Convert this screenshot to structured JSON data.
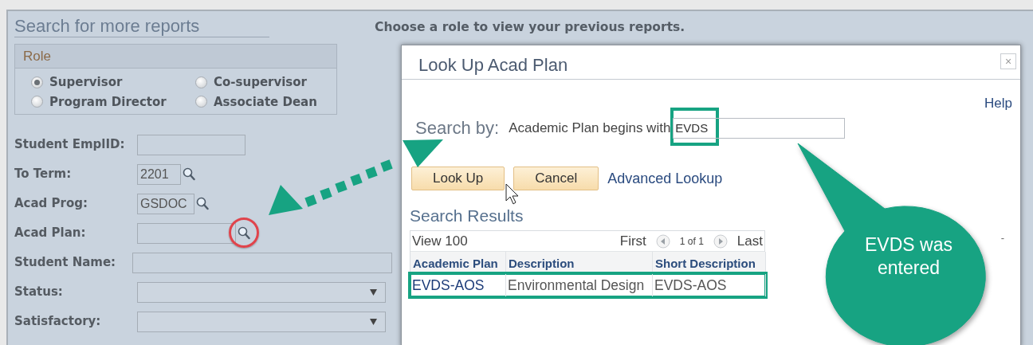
{
  "page": {
    "heading": "Search for more reports",
    "instruction": "Choose a role to view your previous reports."
  },
  "role": {
    "title": "Role",
    "options": [
      {
        "label": "Supervisor",
        "selected": true
      },
      {
        "label": "Co-supervisor",
        "selected": false
      },
      {
        "label": "Program Director",
        "selected": false
      },
      {
        "label": "Associate Dean",
        "selected": false
      }
    ]
  },
  "fields": [
    {
      "label": "Student EmplID:",
      "kind": "text"
    },
    {
      "label": "To Term:",
      "kind": "lookup",
      "value": "2201",
      "highlighted": false
    },
    {
      "label": "Acad Prog:",
      "kind": "lookup",
      "value": "GSDOC",
      "highlighted": false
    },
    {
      "label": "Acad Plan:",
      "kind": "lookup",
      "highlighted": true
    },
    {
      "label": "Student Name:",
      "kind": "text"
    },
    {
      "label": "Status:",
      "kind": "dropdown"
    },
    {
      "label": "Satisfactory:",
      "kind": "dropdown"
    }
  ],
  "dialog": {
    "title": "Look Up Acad Plan",
    "close": "×",
    "help": "Help",
    "search_by": "Search by:",
    "criterion": "Academic Plan begins with",
    "value": "EVDS",
    "buttons": [
      {
        "label": "Look Up"
      },
      {
        "label": "Cancel"
      }
    ],
    "link": "Advanced Lookup",
    "results": {
      "title": "Search Results",
      "view": "View 100",
      "first": "First",
      "page": "1 of 1",
      "last": "Last",
      "columns": [
        "Academic Plan",
        "Description",
        "Short Description"
      ],
      "rows": [
        [
          "EVDS-AOS",
          "Environmental Design",
          "EVDS-AOS"
        ]
      ]
    },
    "mark": "-"
  },
  "callout": {
    "text": "EVDS was entered"
  }
}
